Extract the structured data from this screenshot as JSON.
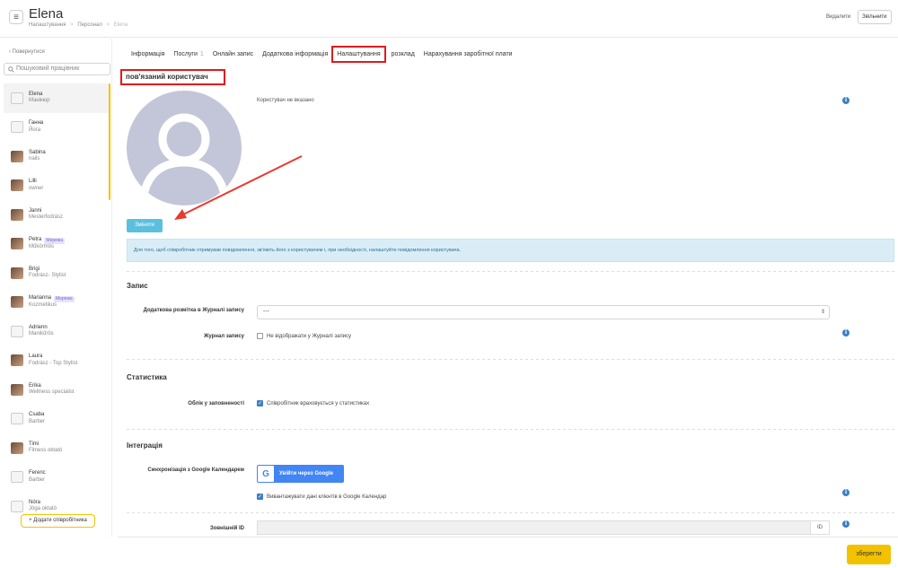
{
  "header": {
    "title": "Elena",
    "breadcrumb": [
      "Налаштування",
      ">",
      "Персонал",
      ">",
      "Elena"
    ],
    "delete_label": "Видалити",
    "fire_label": "Звільнити"
  },
  "sidebar": {
    "back_label": "‹ Повернутися",
    "search_placeholder": "Пошуковий працівник",
    "add_staff_label": "+ Додати співробітника",
    "staff": [
      {
        "name": "Elena",
        "role": "Манікюр",
        "badge": "",
        "photo": false
      },
      {
        "name": "Ганна",
        "role": "Йога",
        "badge": "",
        "photo": false
      },
      {
        "name": "Sabina",
        "role": "nails",
        "badge": "",
        "photo": true
      },
      {
        "name": "Lilli",
        "role": "owner",
        "badge": "",
        "photo": true
      },
      {
        "name": "Janni",
        "role": "Mesterfodrász",
        "badge": "",
        "photo": true
      },
      {
        "name": "Petra",
        "role": "Műkörmös",
        "badge": "Мережа",
        "photo": true
      },
      {
        "name": "Brigi",
        "role": "Fodrász- Stylist",
        "badge": "",
        "photo": true
      },
      {
        "name": "Marianna",
        "role": "Kozmetikus",
        "badge": "Мережа",
        "photo": true
      },
      {
        "name": "Adrienn",
        "role": "Manikűrös",
        "badge": "",
        "photo": false
      },
      {
        "name": "Laura",
        "role": "Fodrász - Top Stylist",
        "badge": "",
        "photo": true
      },
      {
        "name": "Erika",
        "role": "Wellness specialist",
        "badge": "",
        "photo": true
      },
      {
        "name": "Csaba",
        "role": "Barber",
        "badge": "",
        "photo": false
      },
      {
        "name": "Timi",
        "role": "Fitness oktató",
        "badge": "",
        "photo": true
      },
      {
        "name": "Ferenc",
        "role": "Barber",
        "badge": "",
        "photo": false
      },
      {
        "name": "Nóra",
        "role": "Jóga oktató",
        "badge": "",
        "photo": false
      }
    ]
  },
  "tabs": [
    {
      "label": "Інформація",
      "count": ""
    },
    {
      "label": "Послуги",
      "count": "1"
    },
    {
      "label": "Онлайн запис",
      "count": ""
    },
    {
      "label": "Додаткова інформація",
      "count": ""
    },
    {
      "label": "Налаштування",
      "count": "",
      "active": true
    },
    {
      "label": "розклад",
      "count": ""
    },
    {
      "label": "Нарахування заробітної плати",
      "count": ""
    }
  ],
  "linked_user": {
    "title": "пов'язаний користувач",
    "no_user_text": "Користувач не вказано",
    "change_label": "Змінити",
    "alert_text": "Для того, щоб співробітник отримував повідомлення, зв'яжіть його з користувачем і, при необхідності, налаштуйте повідомлення користувача."
  },
  "record": {
    "title": "Запис",
    "markup_label": "Додаткова розмітка в Журналі запису",
    "markup_value": "---",
    "journal_label": "Журнал запису",
    "journal_checkbox": "Не відображати у Журналі запису",
    "journal_checked": false
  },
  "statistics": {
    "title": "Статистика",
    "occupancy_label": "Облік у заповненості",
    "occupancy_checkbox": "Співробітник враховується у статистиках",
    "occupancy_checked": true
  },
  "integration": {
    "title": "Інтеграція",
    "gcal_label": "Синхронізація з Google Календарем",
    "google_button": "Увійти через Google",
    "google_letter": "G",
    "export_checkbox": "Вивантажувати дані клієнтів в Google Календар",
    "export_checked": true,
    "external_id_label": "Зовнішній ID",
    "external_id_addon": "ID"
  },
  "save_label": "зберегти",
  "colors": {
    "accent": "#f2c200",
    "annotation": "#e01b1b",
    "info": "#3d7fc4",
    "change_button": "#5bc0de",
    "google": "#4285f4"
  }
}
